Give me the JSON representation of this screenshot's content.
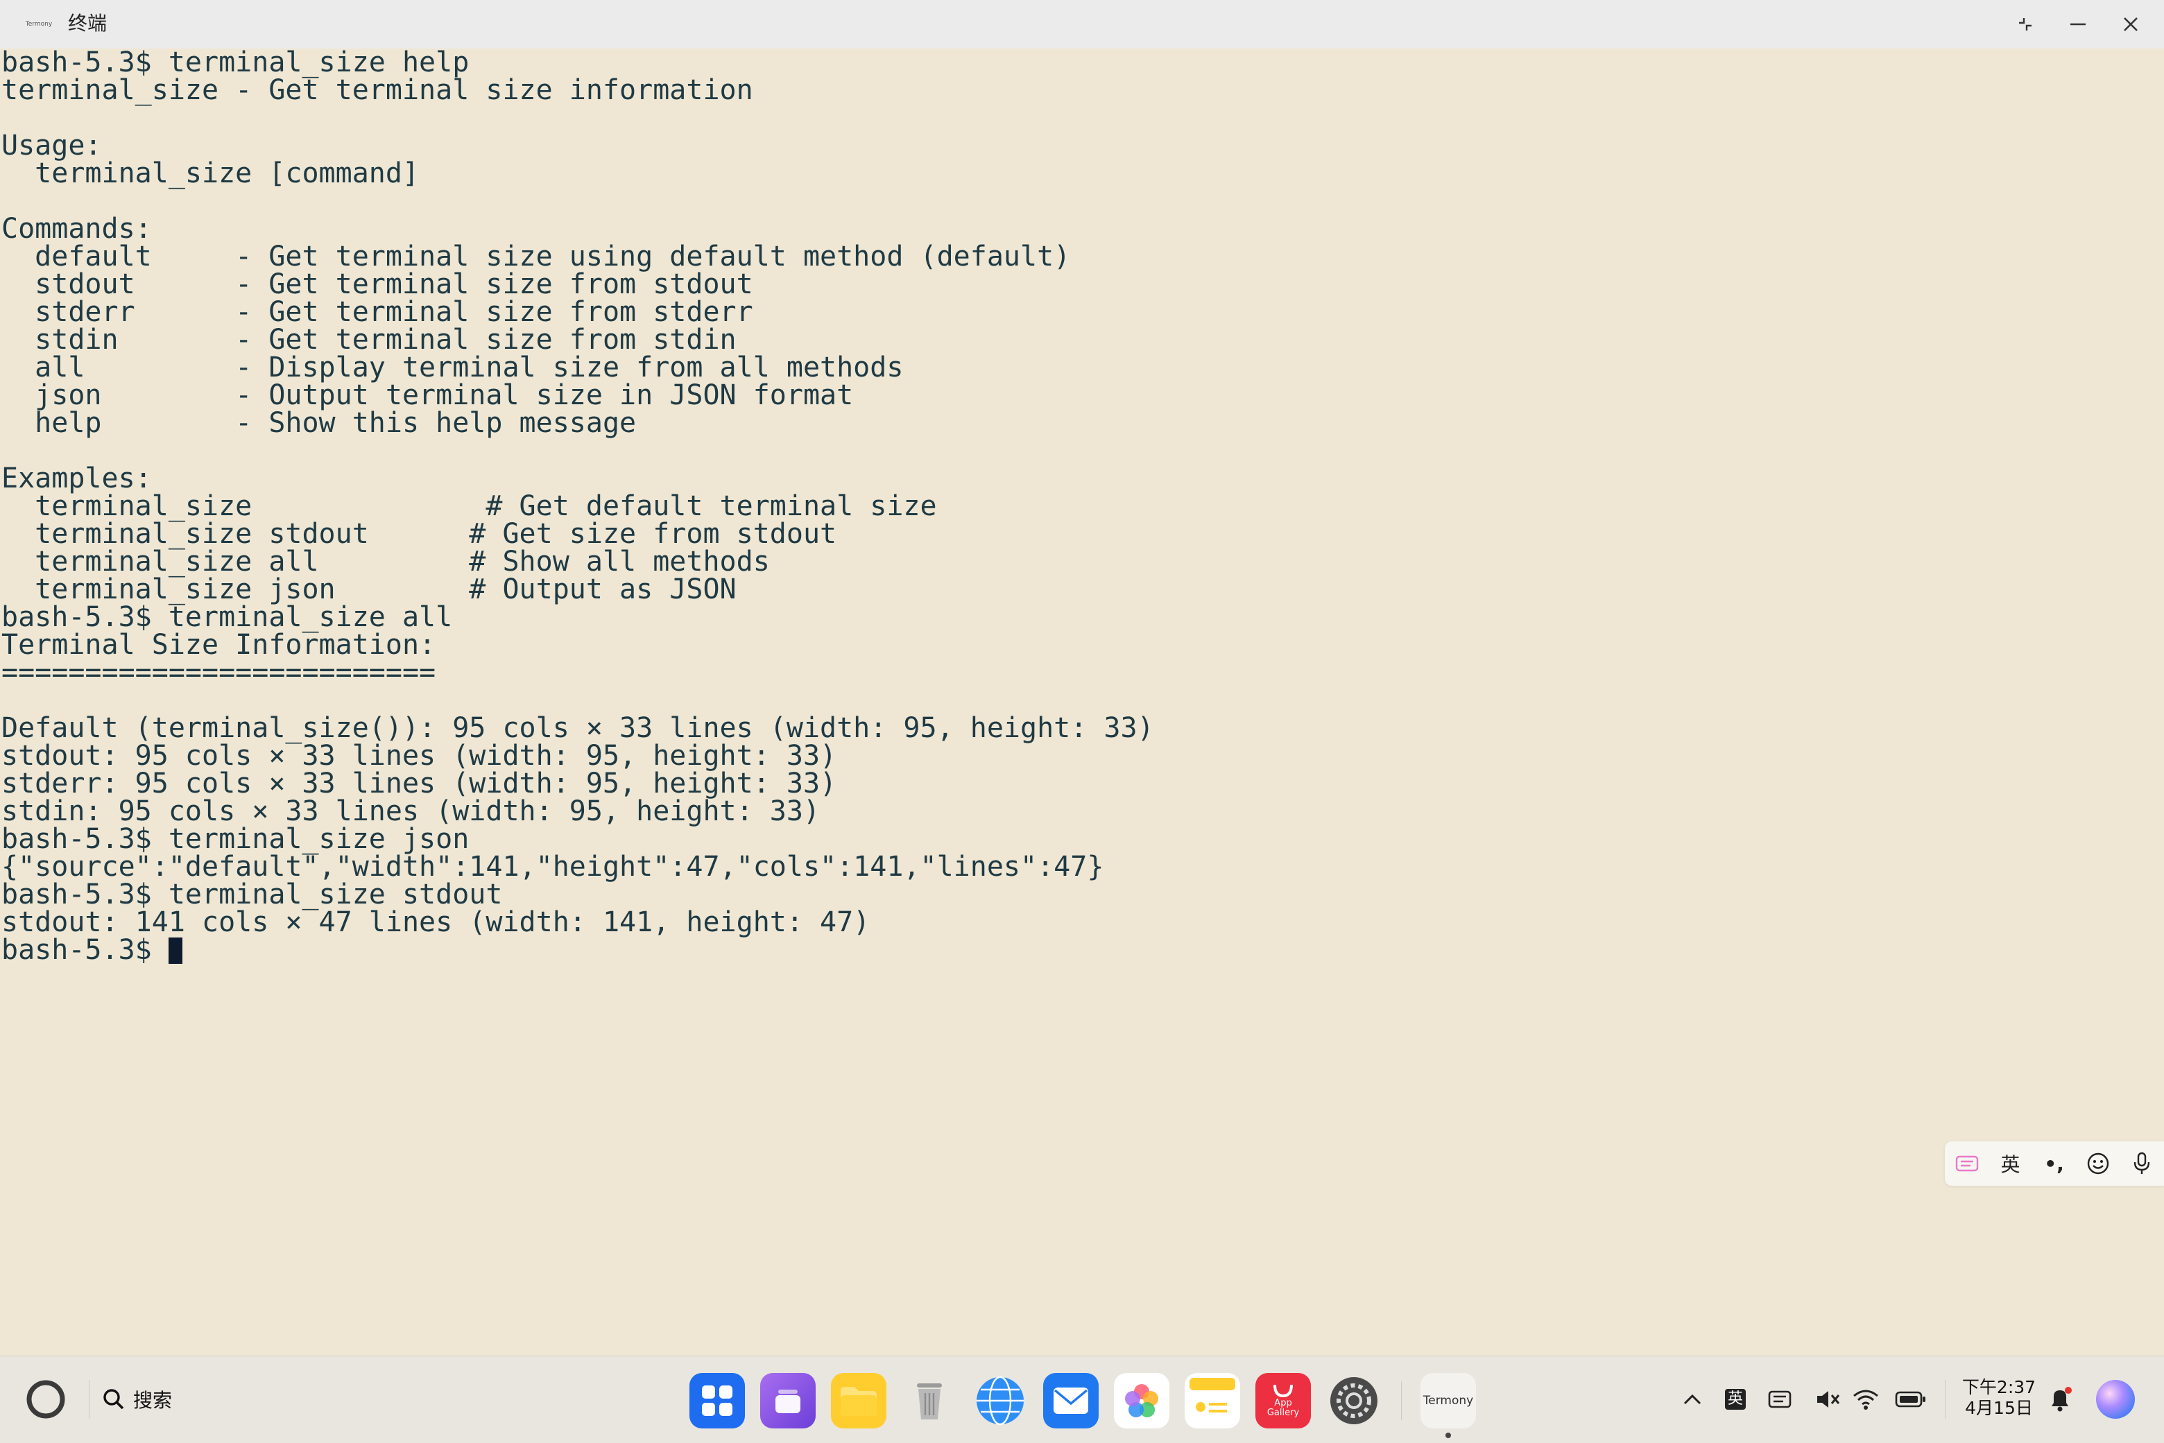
{
  "window": {
    "title": "终端",
    "app_icon_label": "Termony"
  },
  "terminal": {
    "lines": [
      "bash-5.3$ terminal_size help",
      "terminal_size - Get terminal size information",
      "",
      "Usage:",
      "  terminal_size [command]",
      "",
      "Commands:",
      "  default     - Get terminal size using default method (default)",
      "  stdout      - Get terminal size from stdout",
      "  stderr      - Get terminal size from stderr",
      "  stdin       - Get terminal size from stdin",
      "  all         - Display terminal size from all methods",
      "  json        - Output terminal size in JSON format",
      "  help        - Show this help message",
      "",
      "Examples:",
      "  terminal_size              # Get default terminal size",
      "  terminal_size stdout      # Get size from stdout",
      "  terminal_size all         # Show all methods",
      "  terminal_size json        # Output as JSON",
      "bash-5.3$ terminal_size all",
      "Terminal Size Information:",
      "==========================",
      "",
      "Default (terminal_size()): 95 cols × 33 lines (width: 95, height: 33)",
      "stdout: 95 cols × 33 lines (width: 95, height: 33)",
      "stderr: 95 cols × 33 lines (width: 95, height: 33)",
      "stdin: 95 cols × 33 lines (width: 95, height: 33)",
      "bash-5.3$ terminal_size json",
      "{\"source\":\"default\",\"width\":141,\"height\":47,\"cols\":141,\"lines\":47}",
      "bash-5.3$ terminal_size stdout",
      "stdout: 141 cols × 47 lines (width: 141, height: 47)"
    ],
    "prompt": "bash-5.3$ "
  },
  "ime_toolbar": {
    "lang_label": "英",
    "punct_label": "•,"
  },
  "taskbar": {
    "search_label": "搜索",
    "termony_label": "Termony",
    "app_gallery_label": "App\nGallery",
    "ime_label": "英",
    "time": "下午2:37",
    "date": "4月15日"
  },
  "colors": {
    "terminal_bg": "#efe7d4",
    "terminal_fg": "#1f3a44",
    "cursor": "#0e1b2e",
    "taskbar_bg": "#e9e6df"
  }
}
